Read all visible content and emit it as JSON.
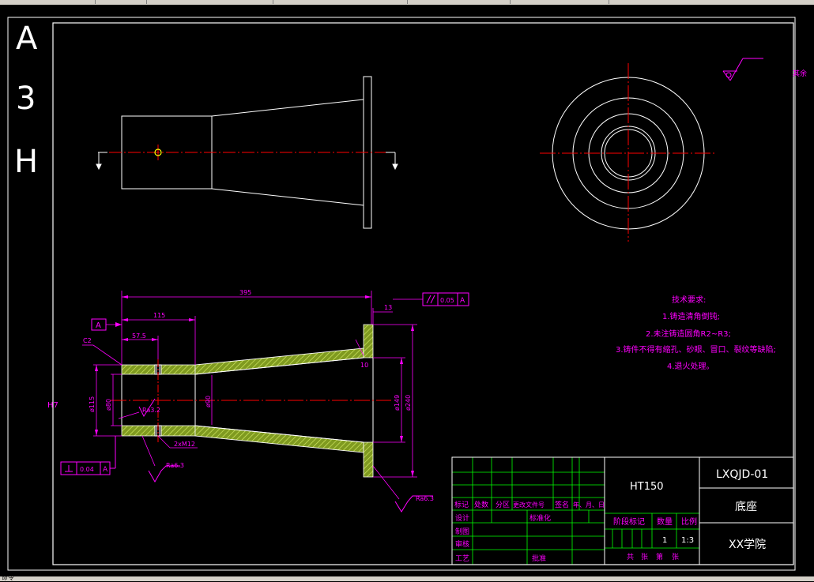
{
  "app": {
    "status_text": "命令"
  },
  "drawing": {
    "sheet_size_letters": [
      "A",
      "3",
      "H"
    ],
    "left_annotation": "H7",
    "surface_mark_top_right": "其余",
    "dimensions": {
      "overall_length": "395",
      "flange_thickness": "13",
      "bore_depth": "115",
      "hole_position": "57.5",
      "fillet_small": "10",
      "chamfer": "C2",
      "dia_outer_left": "ø115",
      "dia_bore": "ø80",
      "dia_inner": "ø90",
      "dia_mid": "ø149",
      "dia_flange": "ø240",
      "thread": "2xM12",
      "roughness_inner": "Ra3.2",
      "roughness_bottom": "Ra6.3",
      "roughness_right": "Ra6.3"
    },
    "tolerances": {
      "parallelism_value": "0.05",
      "parallelism_datum": "A",
      "perp_value": "0.04",
      "perp_datum": "A",
      "datum_label": "A"
    },
    "technical_requirements": {
      "title": "技术要求:",
      "items": [
        "1.铸造清角倒钝;",
        "2.未注铸造圆角R2~R3;",
        "3.铸件不得有缩孔、砂眼、冒口、裂纹等缺陷;",
        "4.退火处理。"
      ]
    },
    "title_block": {
      "material": "HT150",
      "drawing_number": "LXQJD-01",
      "part_name": "底座",
      "school": "XX学院",
      "row_labels": [
        "标记",
        "处数",
        "分区",
        "更改文件号",
        "签名",
        "年、月、日"
      ],
      "sign_labels": [
        "设计",
        "制图",
        "审核",
        "工艺"
      ],
      "standardization": "标准化",
      "approve": "批准",
      "stage_mark": "阶段标记",
      "quantity_label": "数量",
      "scale_label": "比例",
      "quantity": "1",
      "scale": "1:3",
      "sheet_info": [
        "共",
        "张",
        "第",
        "张"
      ]
    }
  },
  "colors": {
    "frame": "#ffffff",
    "center_line": "#ff0000",
    "dimension": "#ff00ff",
    "hatch": "#a0c040",
    "title_grid": "#00ff00"
  }
}
